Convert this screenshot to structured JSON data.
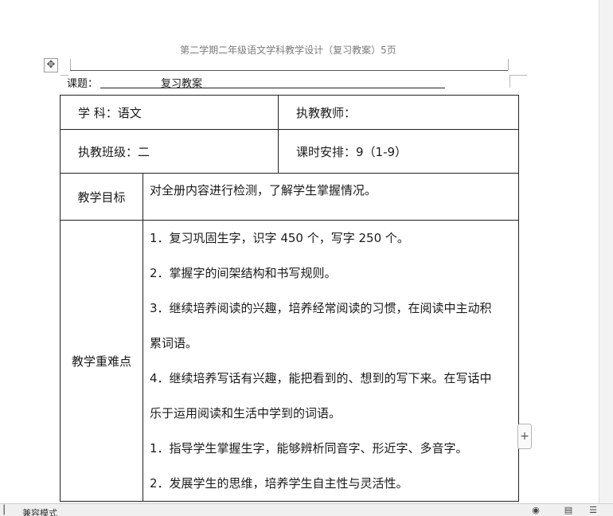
{
  "header": {
    "running_title": "第二学期二年级语文学科教学设计（复习教案）5页"
  },
  "topic": {
    "label": "课题：",
    "value": "复习教案"
  },
  "table": {
    "subject": "学  科：语文",
    "teacher": "执教教师：",
    "class": "执教班级：二",
    "schedule": "课时安排：9（1-9）",
    "goals_label": "教学目标",
    "goals_text": "对全册内容进行检测，了解学生掌握情况。",
    "keypoints_label": "教学重难点",
    "keypoints_lines": [
      "1．复习巩固生字，识字 450 个，写字 250 个。",
      "2．掌握字的间架结构和书写规则。",
      "3．继续培养阅读的兴趣，培养经常阅读的习惯，在阅读中主动积",
      "累词语。",
      "4．继续培养写话有兴趣，能把看到的、想到的写下来。在写话中",
      "乐于运用阅读和生活中学到的词语。",
      "1．指导学生掌握生字，能够辨析同音字、形近字、多音字。",
      "2．发展学生的思维，培养学生自主性与灵活性。"
    ]
  },
  "controls": {
    "move_handle_icon": "move-arrows-icon",
    "add_row_icon": "plus-icon"
  },
  "status_bar": {
    "mode": "兼容模式"
  }
}
